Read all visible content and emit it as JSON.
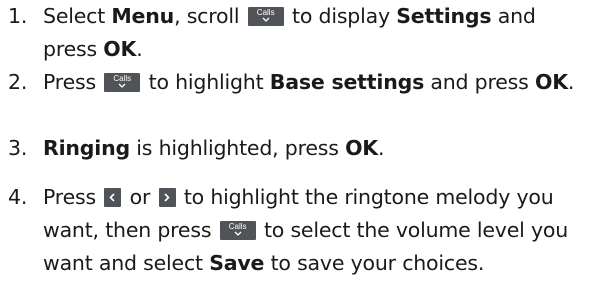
{
  "steps": [
    {
      "num": "1.",
      "parts": {
        "a": "Select ",
        "b": "Menu",
        "c": ", scroll ",
        "d": "to display ",
        "e": "Settings",
        "f": " and press ",
        "g": "OK",
        "h": "."
      }
    },
    {
      "num": "2.",
      "parts": {
        "a": "Press ",
        "b": "to highlight ",
        "c": "Base settings",
        "d": " and press ",
        "e": "OK",
        "f": "."
      }
    },
    {
      "num": "3.",
      "parts": {
        "a": "Ringing",
        "b": " is highlighted, press ",
        "c": "OK",
        "d": "."
      }
    },
    {
      "num": "4.",
      "parts": {
        "a": "Press ",
        "b": " or ",
        "c": "to highlight the ringtone melody you want, then press ",
        "d": "to select the volume level you want and select ",
        "e": "Save",
        "f": " to save your choices."
      }
    }
  ],
  "keys": {
    "calls_label": "Calls"
  },
  "icons": {
    "calls": "calls-down-key-icon",
    "left": "left-arrow-key-icon",
    "right": "right-arrow-key-icon"
  },
  "colors": {
    "text": "#1a1a1a",
    "key_background": "#505357",
    "key_foreground": "#ffffff"
  }
}
